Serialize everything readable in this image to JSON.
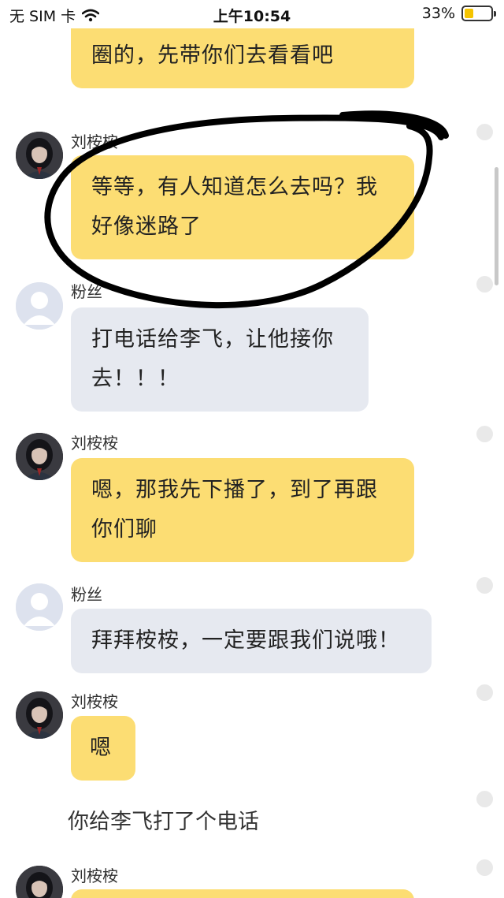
{
  "status_bar": {
    "carrier": "无 SIM 卡",
    "time": "上午10:54",
    "battery_percent": "33%",
    "battery_level": 0.33,
    "wifi_icon": "wifi-icon"
  },
  "colors": {
    "streamer_bubble": "#fcdd73",
    "fan_bubble": "#e6e9f0",
    "annotation_ink": "#000000"
  },
  "messages": [
    {
      "text": "啊哈哈哈，我不怎么关心娱乐圈的，先带你们去看看吧"
    },
    {
      "sender": "刘桉桉",
      "text": "等等，有人知道怎么去吗？我好像迷路了"
    },
    {
      "sender": "粉丝",
      "text": "打电话给李飞，让他接你去！！！"
    },
    {
      "sender": "刘桉桉",
      "text": "嗯，那我先下播了，到了再跟你们聊"
    },
    {
      "sender": "粉丝",
      "text": "拜拜桉桉，一定要跟我们说哦！"
    },
    {
      "sender": "刘桉桉",
      "text": "嗯"
    },
    {
      "system": "你给李飞打了个电话"
    },
    {
      "sender": "刘桉桉",
      "text": ""
    }
  ]
}
